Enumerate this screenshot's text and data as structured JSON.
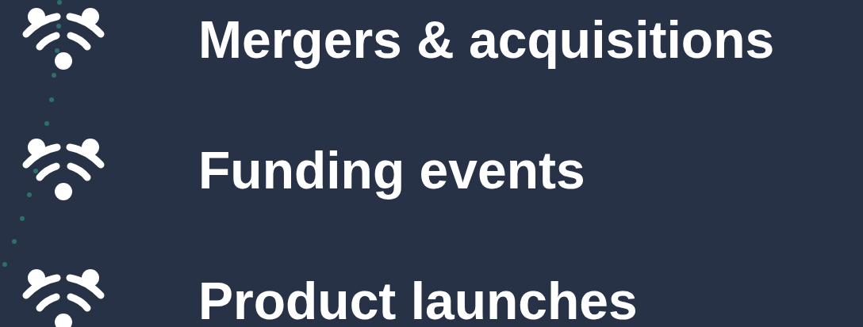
{
  "items": [
    {
      "label": "Mergers & acquisitions"
    },
    {
      "label": "Funding events"
    },
    {
      "label": "Product launches"
    }
  ]
}
